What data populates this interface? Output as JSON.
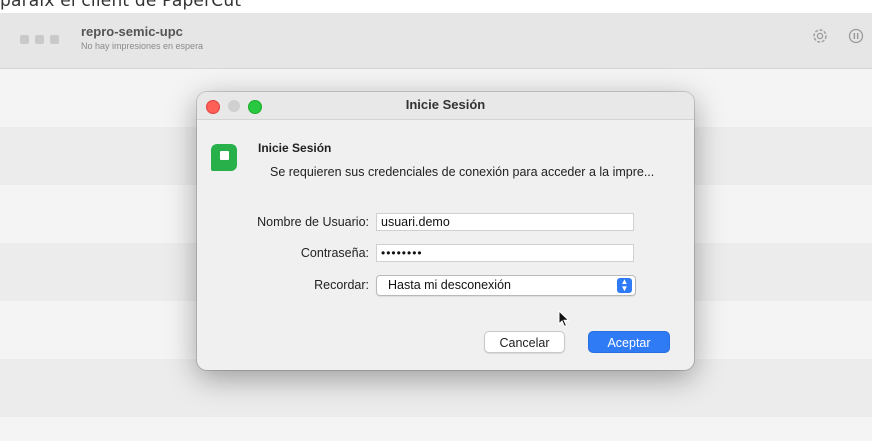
{
  "caption": "paraíx el client de PaperCut",
  "queue_window": {
    "printer_name": "repro-semic-upc",
    "status": "No hay impresiones en espera",
    "icons": [
      "gear-icon",
      "pause-icon"
    ]
  },
  "dialog": {
    "window_title": "Inicie Sesión",
    "header_title": "Inicie Sesión",
    "message": "Se requieren sus credenciales de conexión para acceder a la impre...",
    "username_label": "Nombre de Usuario:",
    "username_value": "usuari.demo",
    "password_label": "Contraseña:",
    "password_value": "••••••••",
    "remember_label": "Recordar:",
    "remember_value": "Hasta mi desconexión",
    "cancel_label": "Cancelar",
    "accept_label": "Aceptar"
  },
  "colors": {
    "accent": "#2f7bf5",
    "app_icon": "#28b04a",
    "close_light": "#fe5f57",
    "zoom_light": "#28c840"
  }
}
